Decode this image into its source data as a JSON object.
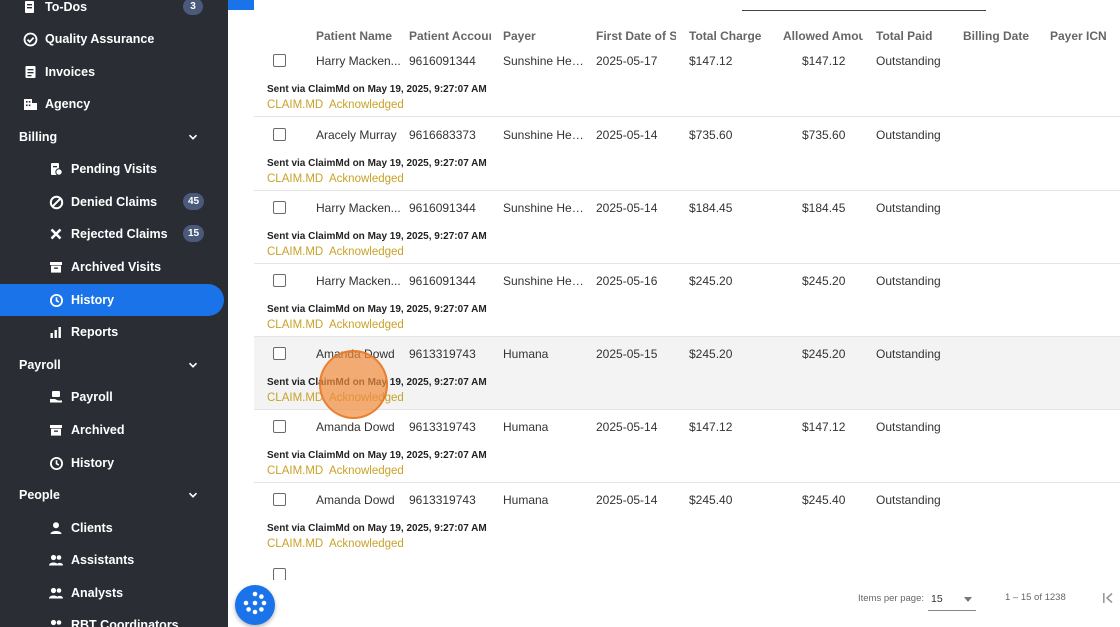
{
  "sidebar": {
    "todos": {
      "label": "To-Dos",
      "badge": "3"
    },
    "quality": {
      "label": "Quality Assurance"
    },
    "invoices": {
      "label": "Invoices"
    },
    "agency": {
      "label": "Agency"
    },
    "billing": {
      "label": "Billing"
    },
    "pending": {
      "label": "Pending Visits"
    },
    "denied": {
      "label": "Denied Claims",
      "badge": "45"
    },
    "rejected": {
      "label": "Rejected Claims",
      "badge": "15"
    },
    "archived_visits": {
      "label": "Archived Visits"
    },
    "history": {
      "label": "History"
    },
    "reports": {
      "label": "Reports"
    },
    "payroll_section": {
      "label": "Payroll"
    },
    "payroll": {
      "label": "Payroll"
    },
    "archived": {
      "label": "Archived"
    },
    "payroll_history": {
      "label": "History"
    },
    "people": {
      "label": "People"
    },
    "clients": {
      "label": "Clients"
    },
    "assistants": {
      "label": "Assistants"
    },
    "analysts": {
      "label": "Analysts"
    },
    "rbt": {
      "label": "RBT Coordinators"
    }
  },
  "table": {
    "headers": [
      "Patient Name",
      "Patient Account",
      "Payer",
      "First Date of Service",
      "Total Charge",
      "Allowed Amount",
      "Total Paid",
      "Billing Date",
      "Payer ICN"
    ],
    "rows": [
      {
        "patient": "Harry Macken...",
        "account": "9616091344",
        "payer": "Sunshine Heal...",
        "date": "2025-05-17",
        "charge": "$147.12",
        "allowed": "$147.12",
        "paid": "Outstanding",
        "sent": "Sent via ClaimMd on May 19, 2025, 9:27:07 AM",
        "claim": "CLAIM.MD",
        "status": "Acknowledged"
      },
      {
        "patient": "Aracely Murray",
        "account": "9616683373",
        "payer": "Sunshine Heal...",
        "date": "2025-05-14",
        "charge": "$735.60",
        "allowed": "$735.60",
        "paid": "Outstanding",
        "sent": "Sent via ClaimMd on May 19, 2025, 9:27:07 AM",
        "claim": "CLAIM.MD",
        "status": "Acknowledged"
      },
      {
        "patient": "Harry Macken...",
        "account": "9616091344",
        "payer": "Sunshine Heal...",
        "date": "2025-05-14",
        "charge": "$184.45",
        "allowed": "$184.45",
        "paid": "Outstanding",
        "sent": "Sent via ClaimMd on May 19, 2025, 9:27:07 AM",
        "claim": "CLAIM.MD",
        "status": "Acknowledged"
      },
      {
        "patient": "Harry Macken...",
        "account": "9616091344",
        "payer": "Sunshine Heal...",
        "date": "2025-05-16",
        "charge": "$245.20",
        "allowed": "$245.20",
        "paid": "Outstanding",
        "sent": "Sent via ClaimMd on May 19, 2025, 9:27:07 AM",
        "claim": "CLAIM.MD",
        "status": "Acknowledged"
      },
      {
        "patient": "Amanda Dowd",
        "account": "9613319743",
        "payer": "Humana",
        "date": "2025-05-15",
        "charge": "$245.20",
        "allowed": "$245.20",
        "paid": "Outstanding",
        "sent": "Sent via ClaimMd on May 19, 2025, 9:27:07 AM",
        "claim": "CLAIM.MD",
        "status": "Acknowledged"
      },
      {
        "patient": "Amanda Dowd",
        "account": "9613319743",
        "payer": "Humana",
        "date": "2025-05-14",
        "charge": "$147.12",
        "allowed": "$147.12",
        "paid": "Outstanding",
        "sent": "Sent via ClaimMd on May 19, 2025, 9:27:07 AM",
        "claim": "CLAIM.MD",
        "status": "Acknowledged"
      },
      {
        "patient": "Amanda Dowd",
        "account": "9613319743",
        "payer": "Humana",
        "date": "2025-05-14",
        "charge": "$245.40",
        "allowed": "$245.40",
        "paid": "Outstanding",
        "sent": "Sent via ClaimMd on May 19, 2025, 9:27:07 AM",
        "claim": "CLAIM.MD",
        "status": "Acknowledged"
      }
    ]
  },
  "footer": {
    "items_per_page_label": "Items per page:",
    "items_per_page_value": "15",
    "range": "1 – 15 of 1238"
  },
  "colors": {
    "sidebar_bg": "#2a2d34",
    "accent": "#1a73e8",
    "status": "#c9a227"
  }
}
